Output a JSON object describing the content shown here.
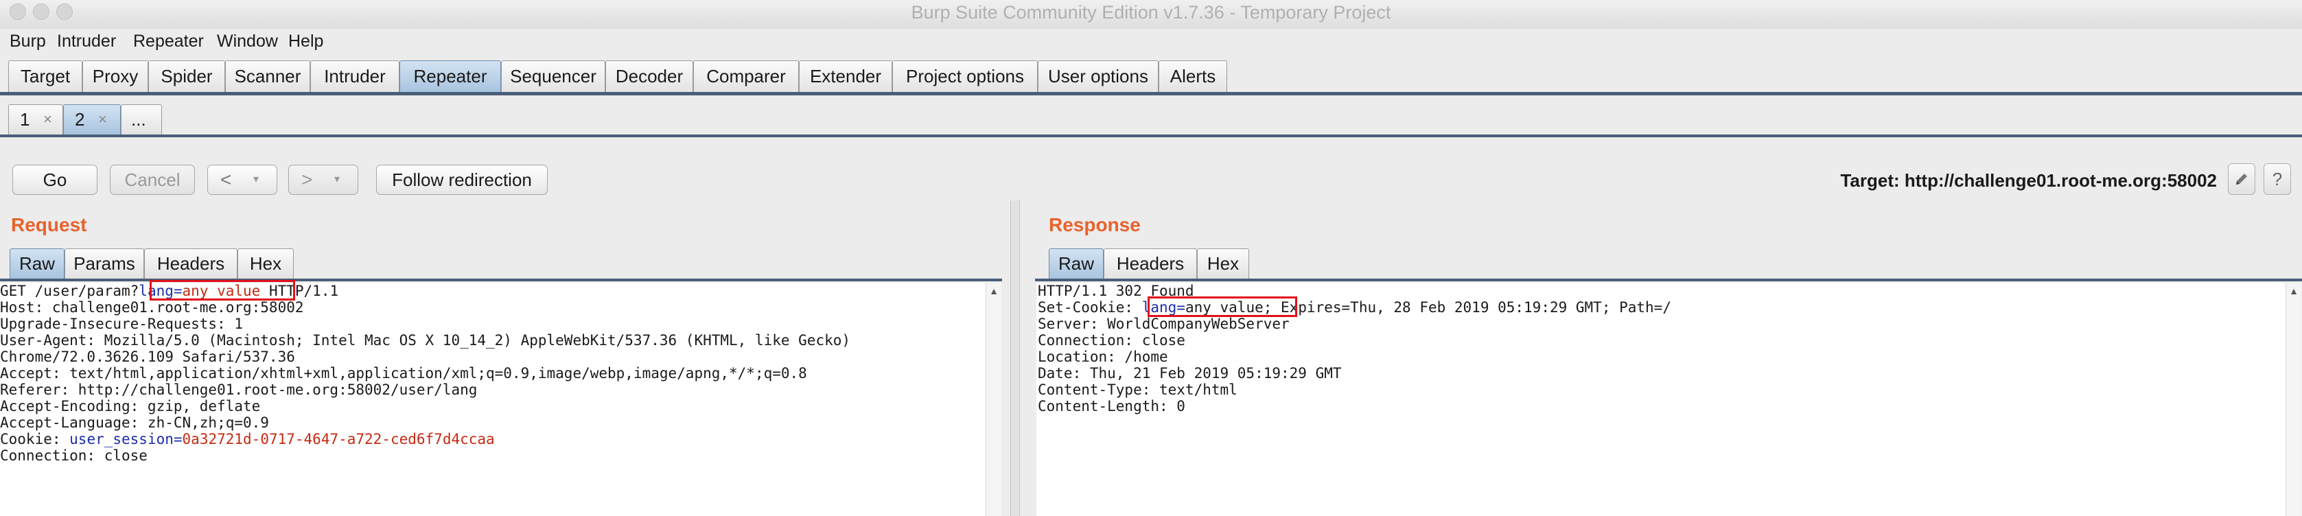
{
  "window": {
    "title": "Burp Suite Community Edition v1.7.36 - Temporary Project"
  },
  "menu": [
    "Burp",
    "Intruder",
    "Repeater",
    "Window",
    "Help"
  ],
  "main_tabs": [
    "Target",
    "Proxy",
    "Spider",
    "Scanner",
    "Intruder",
    "Repeater",
    "Sequencer",
    "Decoder",
    "Comparer",
    "Extender",
    "Project options",
    "User options",
    "Alerts"
  ],
  "active_main_tab": "Repeater",
  "repeater_tabs": [
    {
      "label": "1",
      "close": "×"
    },
    {
      "label": "2",
      "close": "×"
    },
    {
      "label": "..."
    }
  ],
  "toolbar": {
    "go": "Go",
    "cancel": "Cancel",
    "back": "<",
    "forward": ">",
    "dropdown": "▾",
    "follow": "Follow redirection",
    "target": "Target: http://challenge01.root-me.org:58002",
    "edit_icon": "pencil-icon",
    "help_icon": "?"
  },
  "request": {
    "title": "Request",
    "tabs": [
      "Raw",
      "Params",
      "Headers",
      "Hex"
    ],
    "lines": {
      "l1a": "GET /user/param?",
      "l1_key": "lang",
      "l1_eq": "=",
      "l1_val": "any value",
      "l1b": " HTTP/1.1",
      "l2": "Host: challenge01.root-me.org:58002",
      "l3": "Upgrade-Insecure-Requests: 1",
      "l4": "User-Agent: Mozilla/5.0 (Macintosh; Intel Mac OS X 10_14_2) AppleWebKit/537.36 (KHTML, like Gecko)",
      "l5": "Chrome/72.0.3626.109 Safari/537.36",
      "l6": "Accept: text/html,application/xhtml+xml,application/xml;q=0.9,image/webp,image/apng,*/*;q=0.8",
      "l7": "Referer: http://challenge01.root-me.org:58002/user/lang",
      "l8": "Accept-Encoding: gzip, deflate",
      "l9": "Accept-Language: zh-CN,zh;q=0.9",
      "l10a": "Cookie: ",
      "l10_key": "user_session",
      "l10_eq": "=",
      "l10_val": "0a32721d-0717-4647-a722-ced6f7d4ccaa",
      "l11": "Connection: close"
    }
  },
  "response": {
    "title": "Response",
    "tabs": [
      "Raw",
      "Headers",
      "Hex"
    ],
    "lines": {
      "l1": "HTTP/1.1 302 Found",
      "l2a": "Set-Cookie: ",
      "l2_key": "lang",
      "l2_eq": "=",
      "l2_val": "any value;",
      "l2b": " Expires=Thu, 28 Feb 2019 05:19:29 GMT; Path=/",
      "l3": "Server: WorldCompanyWebServer",
      "l4": "Connection: close",
      "l5": "Location: /home",
      "l6": "Date: Thu, 21 Feb 2019 05:19:29 GMT",
      "l7": "Content-Type: text/html",
      "l8": "Content-Length: 0"
    }
  },
  "colors": {
    "accent_title": "#e8622c",
    "tab_active": "#a9c4df",
    "highlight_box": "#e0101a",
    "param_key": "#1c2ea8",
    "param_value": "#c42a12"
  }
}
